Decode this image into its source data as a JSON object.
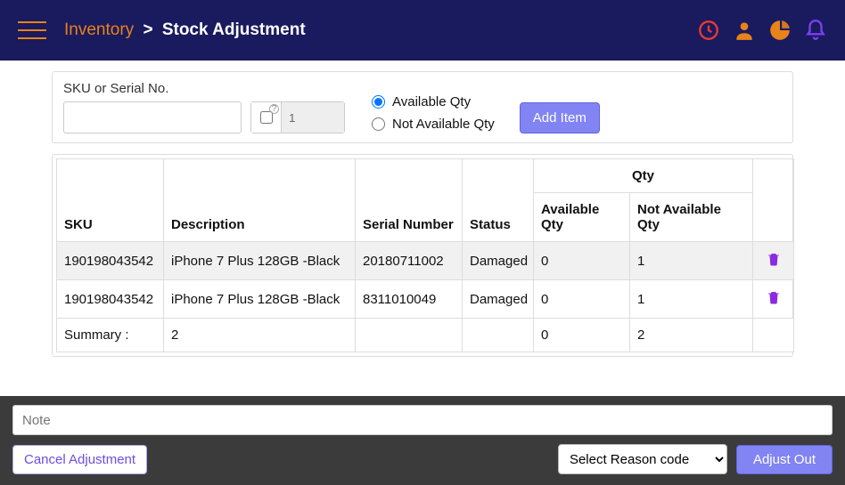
{
  "breadcrumb": {
    "inventory": "Inventory",
    "page": "Stock Adjustment"
  },
  "form": {
    "sku_label": "SKU or Serial No.",
    "sku_value": "",
    "qty_value": "1",
    "radio_available": "Available Qty",
    "radio_not_available": "Not Available Qty",
    "add_item": "Add Item"
  },
  "table": {
    "headers": {
      "sku": "SKU",
      "desc": "Description",
      "serial": "Serial Number",
      "status": "Status",
      "qty": "Qty",
      "avail": "Available Qty",
      "navail": "Not Available Qty"
    },
    "rows": [
      {
        "sku": "190198043542",
        "desc": "iPhone 7 Plus 128GB -Black",
        "serial": "20180711002",
        "status": "Damaged",
        "avail": "0",
        "navail": "1"
      },
      {
        "sku": "190198043542",
        "desc": "iPhone 7 Plus 128GB -Black",
        "serial": "8311010049",
        "status": "Damaged",
        "avail": "0",
        "navail": "1"
      }
    ],
    "summary": {
      "label": "Summary :",
      "count": "2",
      "avail": "0",
      "navail": "2"
    }
  },
  "footer": {
    "note_placeholder": "Note",
    "cancel": "Cancel Adjustment",
    "reason_placeholder": "Select Reason code",
    "adjust": "Adjust Out"
  }
}
